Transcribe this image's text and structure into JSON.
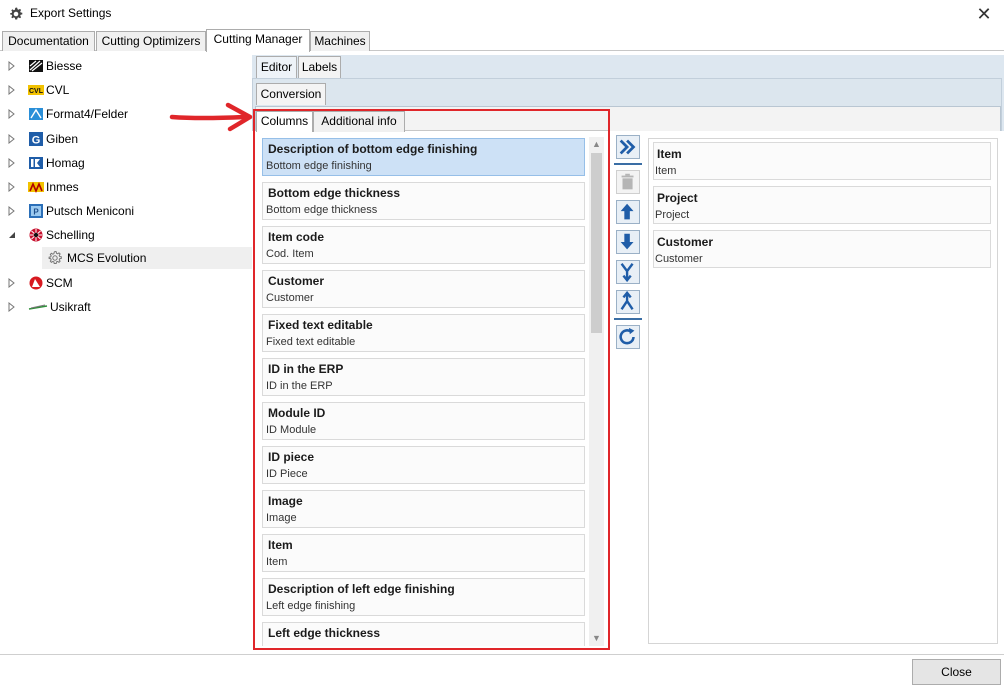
{
  "window": {
    "title": "Export Settings"
  },
  "main_tabs": [
    "Documentation",
    "Cutting Optimizers",
    "Cutting Manager",
    "Machines"
  ],
  "tree": {
    "items": [
      {
        "label": "Biesse",
        "icon": "biesse-logo-icon"
      },
      {
        "label": "CVL",
        "icon": "cvl-logo-icon"
      },
      {
        "label": "Format4/Felder",
        "icon": "format4-logo-icon"
      },
      {
        "label": "Giben",
        "icon": "giben-logo-icon"
      },
      {
        "label": "Homag",
        "icon": "homag-logo-icon"
      },
      {
        "label": "Inmes",
        "icon": "inmes-logo-icon"
      },
      {
        "label": "Putsch Meniconi",
        "icon": "putsch-logo-icon"
      },
      {
        "label": "Schelling",
        "icon": "schelling-logo-icon"
      },
      {
        "label": "SCM",
        "icon": "scm-logo-icon"
      },
      {
        "label": "Usikraft",
        "icon": "usikraft-logo-icon"
      }
    ],
    "child": {
      "label": "MCS Evolution",
      "icon": "gear-icon"
    },
    "cvl_badge": "CVL",
    "giben_badge": "G",
    "putsch_badge": "P"
  },
  "sub_tabs": [
    "Editor",
    "Labels"
  ],
  "conversion_tab": "Conversion",
  "column_tabs": [
    "Columns",
    "Additional info"
  ],
  "available_columns": [
    {
      "name": "Description of bottom edge finishing",
      "sub": "Bottom edge finishing"
    },
    {
      "name": "Bottom edge thickness",
      "sub": "Bottom edge thickness"
    },
    {
      "name": "Item code",
      "sub": "Cod. Item"
    },
    {
      "name": "Customer",
      "sub": "Customer"
    },
    {
      "name": "Fixed text editable",
      "sub": "Fixed text editable"
    },
    {
      "name": "ID in the ERP",
      "sub": "ID in the ERP"
    },
    {
      "name": "Module ID",
      "sub": "ID Module"
    },
    {
      "name": "ID piece",
      "sub": "ID Piece"
    },
    {
      "name": "Image",
      "sub": "Image"
    },
    {
      "name": "Item",
      "sub": "Item"
    },
    {
      "name": "Description of left edge finishing",
      "sub": "Left edge finishing"
    },
    {
      "name": "Left edge thickness",
      "sub": ""
    }
  ],
  "selected_columns": [
    {
      "name": "Item",
      "sub": "Item"
    },
    {
      "name": "Project",
      "sub": "Project"
    },
    {
      "name": "Customer",
      "sub": "Customer"
    }
  ],
  "toolbar_icons": [
    "double-chevron-right-icon",
    "trash-icon",
    "arrow-up-icon",
    "arrow-down-icon",
    "merge-down-icon",
    "split-up-icon",
    "refresh-icon"
  ],
  "footer": {
    "close_label": "Close"
  },
  "colors": {
    "highlight": "#e0262a",
    "selection": "#cde1f6",
    "accent": "#1f5da8"
  }
}
